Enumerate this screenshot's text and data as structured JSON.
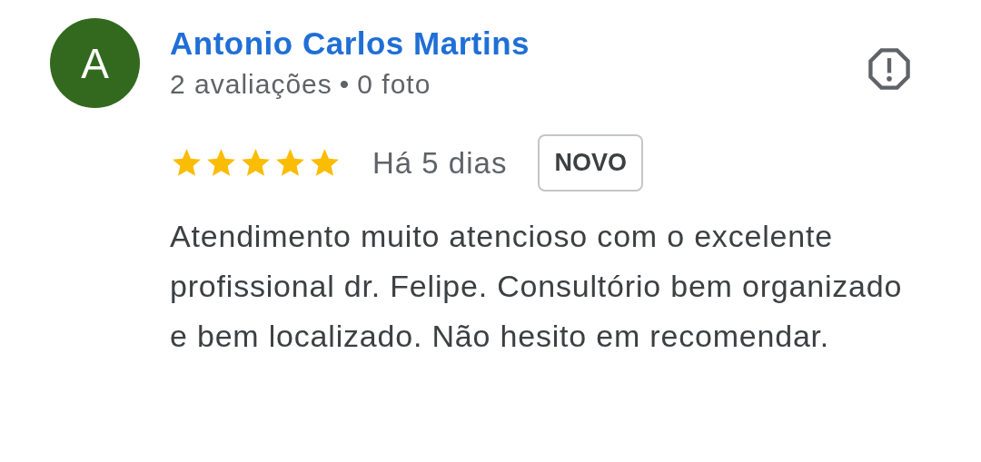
{
  "review": {
    "avatar_letter": "A",
    "author": "Antonio Carlos Martins",
    "reviews_count": "2 avaliações",
    "separator": "•",
    "photos_count": "0 foto",
    "stars": 5,
    "time": "Há 5 dias",
    "badge": "NOVO",
    "text": "Atendimento muito atencioso com o excelente profissional dr. Felipe. Consultório bem organizado e bem localizado. Não hesito em recomendar."
  }
}
